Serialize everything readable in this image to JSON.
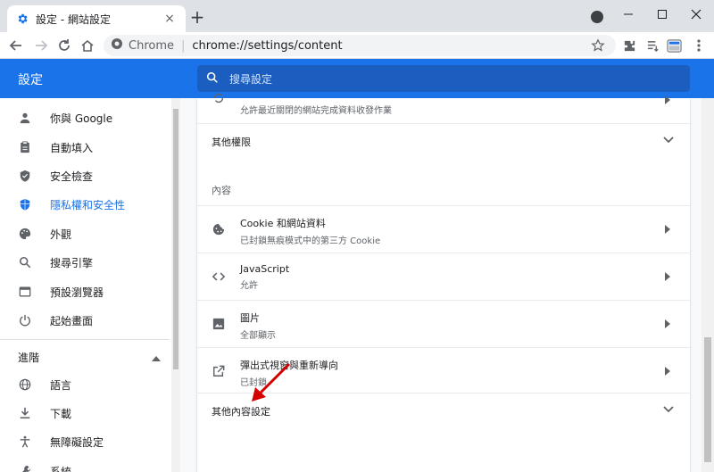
{
  "tab": {
    "title": "設定 - 網站設定",
    "close": "×"
  },
  "newtab": "+",
  "omnibox": {
    "scheme": "Chrome",
    "separator": "|",
    "url": "chrome://settings/content"
  },
  "header": {
    "title": "設定",
    "search_placeholder": "搜尋設定"
  },
  "sidebar": {
    "items": [
      {
        "label": "你與 Google"
      },
      {
        "label": "自動填入"
      },
      {
        "label": "安全檢查"
      },
      {
        "label": "隱私權和安全性"
      },
      {
        "label": "外觀"
      },
      {
        "label": "搜尋引擎"
      },
      {
        "label": "預設瀏覽器"
      },
      {
        "label": "起始畫面"
      }
    ],
    "advanced_label": "進階",
    "advanced_items": [
      {
        "label": "語言"
      },
      {
        "label": "下載"
      },
      {
        "label": "無障礙設定"
      },
      {
        "label": "系統"
      }
    ]
  },
  "content": {
    "top_row_secondary": "允許最近關閉的網站完成資料收發作業",
    "other_permissions": "其他權限",
    "section_label": "內容",
    "rows": [
      {
        "primary": "Cookie 和網站資料",
        "secondary": "已封鎖無痕模式中的第三方 Cookie"
      },
      {
        "primary": "JavaScript",
        "secondary": "允許"
      },
      {
        "primary": "圖片",
        "secondary": "全部顯示"
      },
      {
        "primary": "彈出式視窗與重新導向",
        "secondary": "已封鎖"
      }
    ],
    "more_content_settings": "其他內容設定"
  },
  "colors": {
    "accent": "#1a73e8",
    "header": "#1a73e8",
    "annotation_arrow": "#d40000"
  }
}
